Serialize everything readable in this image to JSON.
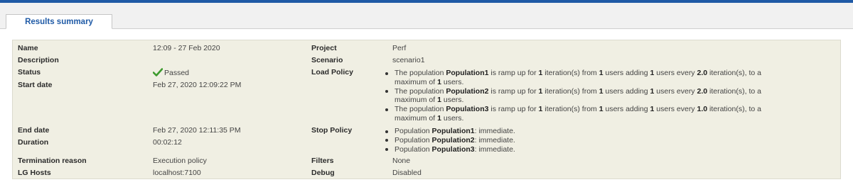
{
  "tab": {
    "label": "Results summary"
  },
  "left": {
    "name": {
      "label": "Name",
      "value": "12:09 - 27 Feb 2020"
    },
    "description": {
      "label": "Description",
      "value": ""
    },
    "status": {
      "label": "Status",
      "value": "Passed",
      "icon": "check-icon",
      "color": "#3c9a2d"
    },
    "start_date": {
      "label": "Start date",
      "value": "Feb 27, 2020 12:09:22 PM"
    },
    "end_date": {
      "label": "End date",
      "value": "Feb 27, 2020 12:11:35 PM"
    },
    "duration": {
      "label": "Duration",
      "value": "00:02:12"
    },
    "termination": {
      "label": "Termination reason",
      "value": "Execution policy"
    },
    "lg_hosts": {
      "label": "LG Hosts",
      "value": "localhost:7100"
    }
  },
  "right": {
    "project": {
      "label": "Project",
      "value": "Perf"
    },
    "scenario": {
      "label": "Scenario",
      "value": "scenario1"
    },
    "load_policy": {
      "label": "Load Policy",
      "items": [
        {
          "p1": "The population ",
          "pop": "Population1",
          "p2": " is ramp up  for ",
          "iter": "1",
          "p3": " iteration(s)  from ",
          "from": "1",
          "p4": " users  adding ",
          "add": "1",
          "p5": " users  every ",
          "every": "2.0",
          "p6": " iteration(s), to a",
          "p7": "maximum of ",
          "max": "1",
          "p8": " users."
        },
        {
          "p1": "The population ",
          "pop": "Population2",
          "p2": " is ramp up  for ",
          "iter": "1",
          "p3": " iteration(s)  from ",
          "from": "1",
          "p4": " users  adding ",
          "add": "1",
          "p5": " users  every ",
          "every": "2.0",
          "p6": " iteration(s), to a",
          "p7": "maximum of ",
          "max": "1",
          "p8": " users."
        },
        {
          "p1": "The population ",
          "pop": "Population3",
          "p2": " is ramp up  for ",
          "iter": "1",
          "p3": " iteration(s)  from ",
          "from": "1",
          "p4": " users  adding ",
          "add": "1",
          "p5": " users  every ",
          "every": "1.0",
          "p6": " iteration(s), to a",
          "p7": "maximum of ",
          "max": "1",
          "p8": " users."
        }
      ]
    },
    "stop_policy": {
      "label": "Stop Policy",
      "items": [
        {
          "prefix": "Population ",
          "pop": "Population1",
          "suffix": ": immediate."
        },
        {
          "prefix": "Population ",
          "pop": "Population2",
          "suffix": ": immediate."
        },
        {
          "prefix": "Population ",
          "pop": "Population3",
          "suffix": ": immediate."
        }
      ]
    },
    "filters": {
      "label": "Filters",
      "value": "None"
    },
    "debug": {
      "label": "Debug",
      "value": "Disabled"
    }
  }
}
